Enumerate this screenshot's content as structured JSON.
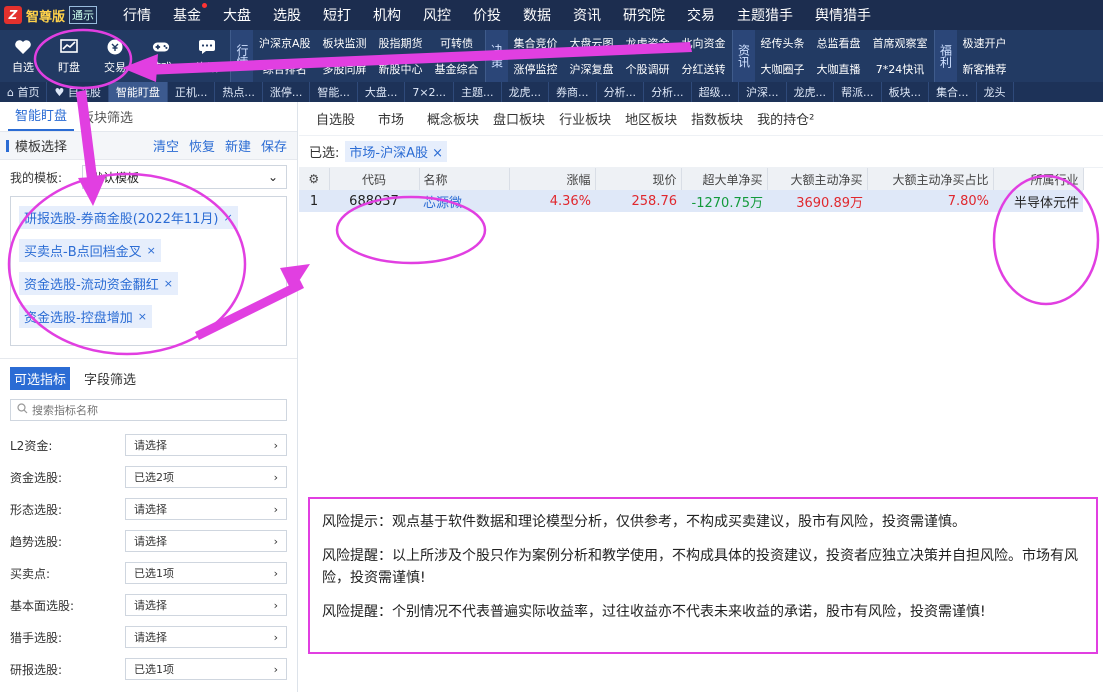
{
  "app": {
    "brand_name": "智尊版",
    "brand_badge": "通示",
    "menu": [
      "行情",
      "基金",
      "大盘",
      "选股",
      "短打",
      "机构",
      "风控",
      "价投",
      "数据",
      "资讯",
      "研究院",
      "交易",
      "主题猎手",
      "舆情猎手"
    ]
  },
  "toolbar": {
    "tools": [
      {
        "label": "自选",
        "icon": "heart-icon"
      },
      {
        "label": "盯盘",
        "icon": "chart-icon"
      },
      {
        "label": "交易",
        "icon": "coin-icon"
      },
      {
        "label": "游戏",
        "icon": "gamepad-icon"
      },
      {
        "label": "资讯",
        "icon": "chat-icon"
      }
    ],
    "groups": [
      {
        "tag": "行情",
        "cells": [
          "沪深京A股",
          "综合排名",
          "板块监测",
          "多股同屏",
          "股指期货",
          "新股中心",
          "可转债",
          "基金综合"
        ]
      },
      {
        "tag": "决策",
        "cells": [
          "集合竞价",
          "涨停监控",
          "大盘云图",
          "沪深复盘",
          "龙虎资金",
          "个股调研",
          "北向资金",
          "分红送转"
        ]
      },
      {
        "tag": "资讯",
        "cells": [
          "经传头条",
          "大咖圈子",
          "总监看盘",
          "大咖直播",
          "首席观察室",
          "7*24快讯"
        ]
      },
      {
        "tag": "福利",
        "cells": [
          "极速开户",
          "新客推荐"
        ]
      }
    ]
  },
  "tabs": [
    "首页",
    "自选股",
    "智能盯盘",
    "正机...",
    "热点...",
    "涨停...",
    "智能...",
    "大盘...",
    "7×2...",
    "主题...",
    "龙虎...",
    "券商...",
    "分析...",
    "分析...",
    "超级...",
    "沪深...",
    "龙虎...",
    "帮派...",
    "板块...",
    "集合...",
    "龙头"
  ],
  "left": {
    "subtabs": [
      "智能盯盘",
      "板块筛选"
    ],
    "template_title": "模板选择",
    "actions": [
      "清空",
      "恢复",
      "新建",
      "保存"
    ],
    "my_template_label": "我的模板:",
    "my_template_value": "默认模板",
    "tags": [
      "研报选股-券商金股(2022年11月)",
      "买卖点-B点回档金叉",
      "资金选股-流动资金翻红",
      "资金选股-控盘增加"
    ],
    "indicator_tabs": [
      "可选指标",
      "字段筛选"
    ],
    "search_placeholder": "搜索指标名称",
    "filters": [
      {
        "label": "L2资金:",
        "value": "请选择"
      },
      {
        "label": "资金选股:",
        "value": "已选2项"
      },
      {
        "label": "形态选股:",
        "value": "请选择"
      },
      {
        "label": "趋势选股:",
        "value": "请选择"
      },
      {
        "label": "买卖点:",
        "value": "已选1项"
      },
      {
        "label": "基本面选股:",
        "value": "请选择"
      },
      {
        "label": "猎手选股:",
        "value": "请选择"
      },
      {
        "label": "研报选股:",
        "value": "已选1项"
      }
    ]
  },
  "right": {
    "category_tabs": [
      "自选股",
      "市场",
      "概念板块",
      "盘口板块",
      "行业板块",
      "地区板块",
      "指数板块",
      "我的持仓"
    ],
    "selected_label": "已选:",
    "selected_chip": "市场-沪深A股",
    "columns": [
      "代码",
      "名称",
      "涨幅",
      "现价",
      "超大单净买",
      "大额主动净买",
      "大额主动净买占比",
      "所属行业"
    ],
    "rows": [
      {
        "index": "1",
        "code": "688037",
        "name": "芯源微",
        "change": "4.36%",
        "price": "258.76",
        "super_net": "-1270.75万",
        "large_net": "3690.89万",
        "large_ratio": "7.80%",
        "industry": "半导体元件"
      }
    ]
  },
  "risk": [
    "风险提示：观点基于软件数据和理论模型分析，仅供参考，不构成买卖建议，股市有风险，投资需谨慎。",
    "风险提醒：以上所涉及个股只作为案例分析和教学使用，不构成具体的投资建议，投资者应独立决策并自担风险。市场有风险，投资需谨慎!",
    "风险提醒：个别情况不代表普遍实际收益率，过往收益亦不代表未来收益的承诺，股市有风险，投资需谨慎!"
  ],
  "colors": {
    "annotation": "#e13fe1",
    "up": "#e0282e",
    "down": "#139a3b",
    "accent": "#2b6cd4"
  }
}
